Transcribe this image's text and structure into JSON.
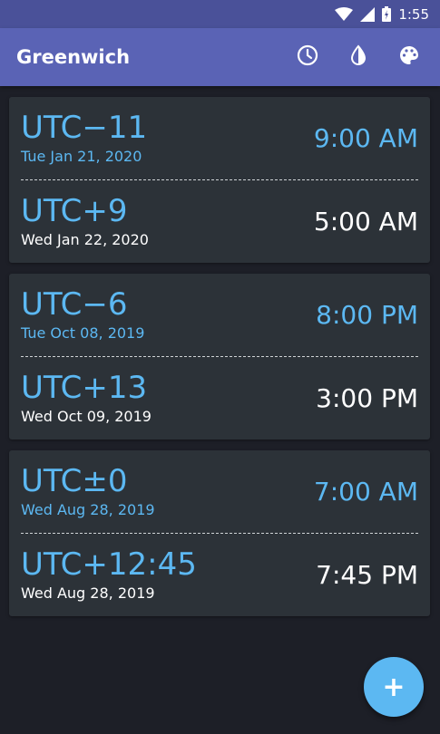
{
  "status_bar": {
    "time": "1:55"
  },
  "app_bar": {
    "title": "Greenwich",
    "actions": [
      "clock-icon",
      "contrast-icon",
      "palette-icon"
    ]
  },
  "cards": [
    {
      "primary": {
        "zone": "UTC−11",
        "date": "Tue Jan 21, 2020",
        "time": "9:00 AM"
      },
      "secondary": {
        "zone": "UTC+9",
        "date": "Wed Jan 22, 2020",
        "time": "5:00 AM"
      }
    },
    {
      "primary": {
        "zone": "UTC−6",
        "date": "Tue Oct 08, 2019",
        "time": "8:00 PM"
      },
      "secondary": {
        "zone": "UTC+13",
        "date": "Wed Oct 09, 2019",
        "time": "3:00 PM"
      }
    },
    {
      "primary": {
        "zone": "UTC±0",
        "date": "Wed Aug 28, 2019",
        "time": "7:00 AM"
      },
      "secondary": {
        "zone": "UTC+12:45",
        "date": "Wed Aug 28, 2019",
        "time": "7:45 PM"
      }
    }
  ],
  "fab": {
    "label": "+"
  },
  "colors": {
    "accent": "#5cb8f2",
    "app_bar": "#5a63b5",
    "status_bar": "#4a5199",
    "card": "#2c3238",
    "background": "#1d1f27"
  }
}
